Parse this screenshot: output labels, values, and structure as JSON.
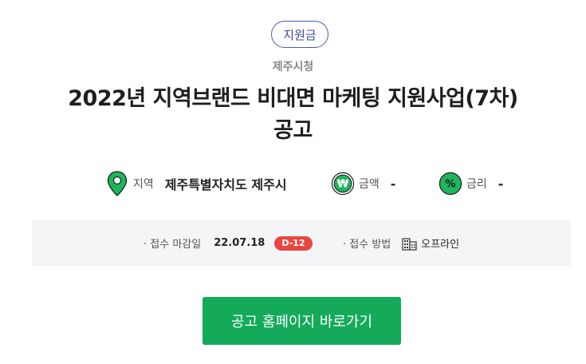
{
  "badge": "지원금",
  "organization": "제주시청",
  "title_line1": "2022년 지역브랜드 비대면 마케팅 지원사업(7차)",
  "title_line2": "공고",
  "info": {
    "region_label": "지역",
    "region_value": "제주특별자치도 제주시",
    "amount_label": "금액",
    "amount_value": "-",
    "rate_label": "금리",
    "rate_value": "-"
  },
  "deadline": {
    "label": "· 접수 마감일",
    "date": "22.07.18",
    "dday": "D-12"
  },
  "method": {
    "label": "· 접수 방법",
    "value": "오프라인"
  },
  "cta_label": "공고 홈페이지 바로가기",
  "icons": {
    "region": "location-pin-icon",
    "amount": "won-coin-icon",
    "rate": "percent-icon",
    "method": "building-icon"
  },
  "colors": {
    "accent_green": "#14aa5a",
    "badge_border": "#4a5aa8",
    "dday_red": "#e8473f"
  }
}
